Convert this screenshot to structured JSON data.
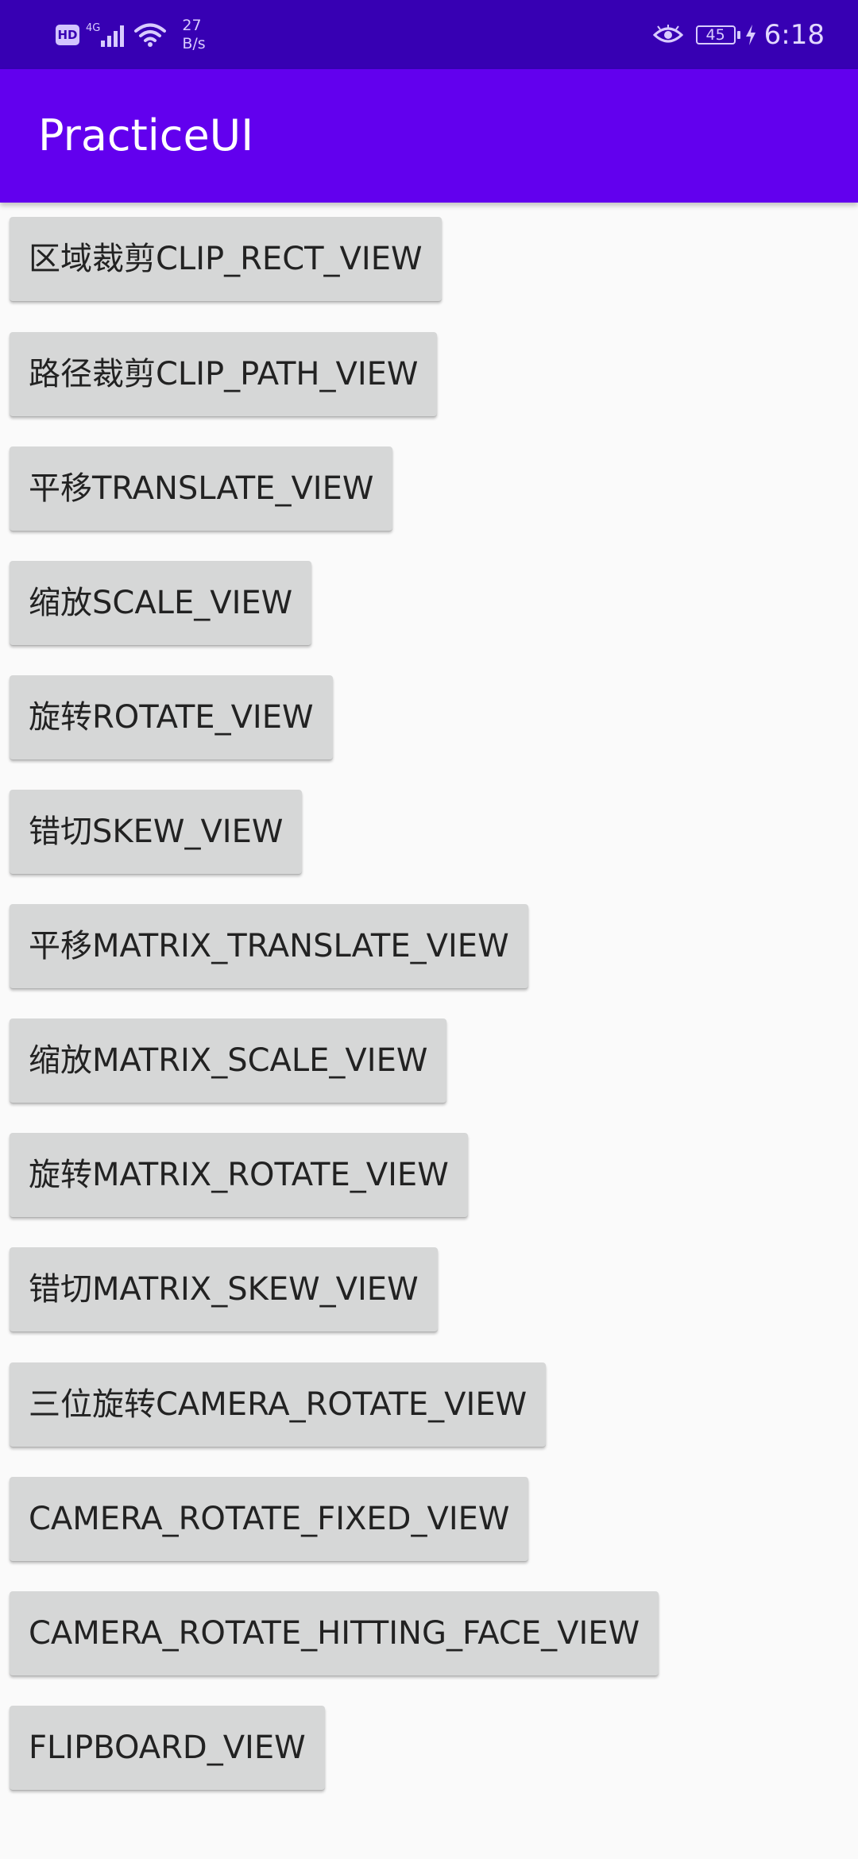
{
  "status_bar": {
    "hd_badge": "HD",
    "network_type": "4G",
    "speed_value": "27",
    "speed_unit": "B/s",
    "battery": "45",
    "time": "6:18",
    "icons": [
      "hd-icon",
      "signal-icon",
      "wifi-icon",
      "eye-comfort-icon",
      "battery-icon",
      "charging-icon"
    ]
  },
  "app_bar": {
    "title": "PracticeUI",
    "color": "#6200ee",
    "status_color": "#3700b3"
  },
  "buttons": [
    "区域裁剪CLIP_RECT_VIEW",
    "路径裁剪CLIP_PATH_VIEW",
    "平移TRANSLATE_VIEW",
    "缩放SCALE_VIEW",
    "旋转ROTATE_VIEW",
    "错切SKEW_VIEW",
    "平移MATRIX_TRANSLATE_VIEW",
    "缩放MATRIX_SCALE_VIEW",
    "旋转MATRIX_ROTATE_VIEW",
    "错切MATRIX_SKEW_VIEW",
    "三位旋转CAMERA_ROTATE_VIEW",
    "CAMERA_ROTATE_FIXED_VIEW",
    "CAMERA_ROTATE_HITTING_FACE_VIEW",
    "FLIPBOARD_VIEW"
  ]
}
